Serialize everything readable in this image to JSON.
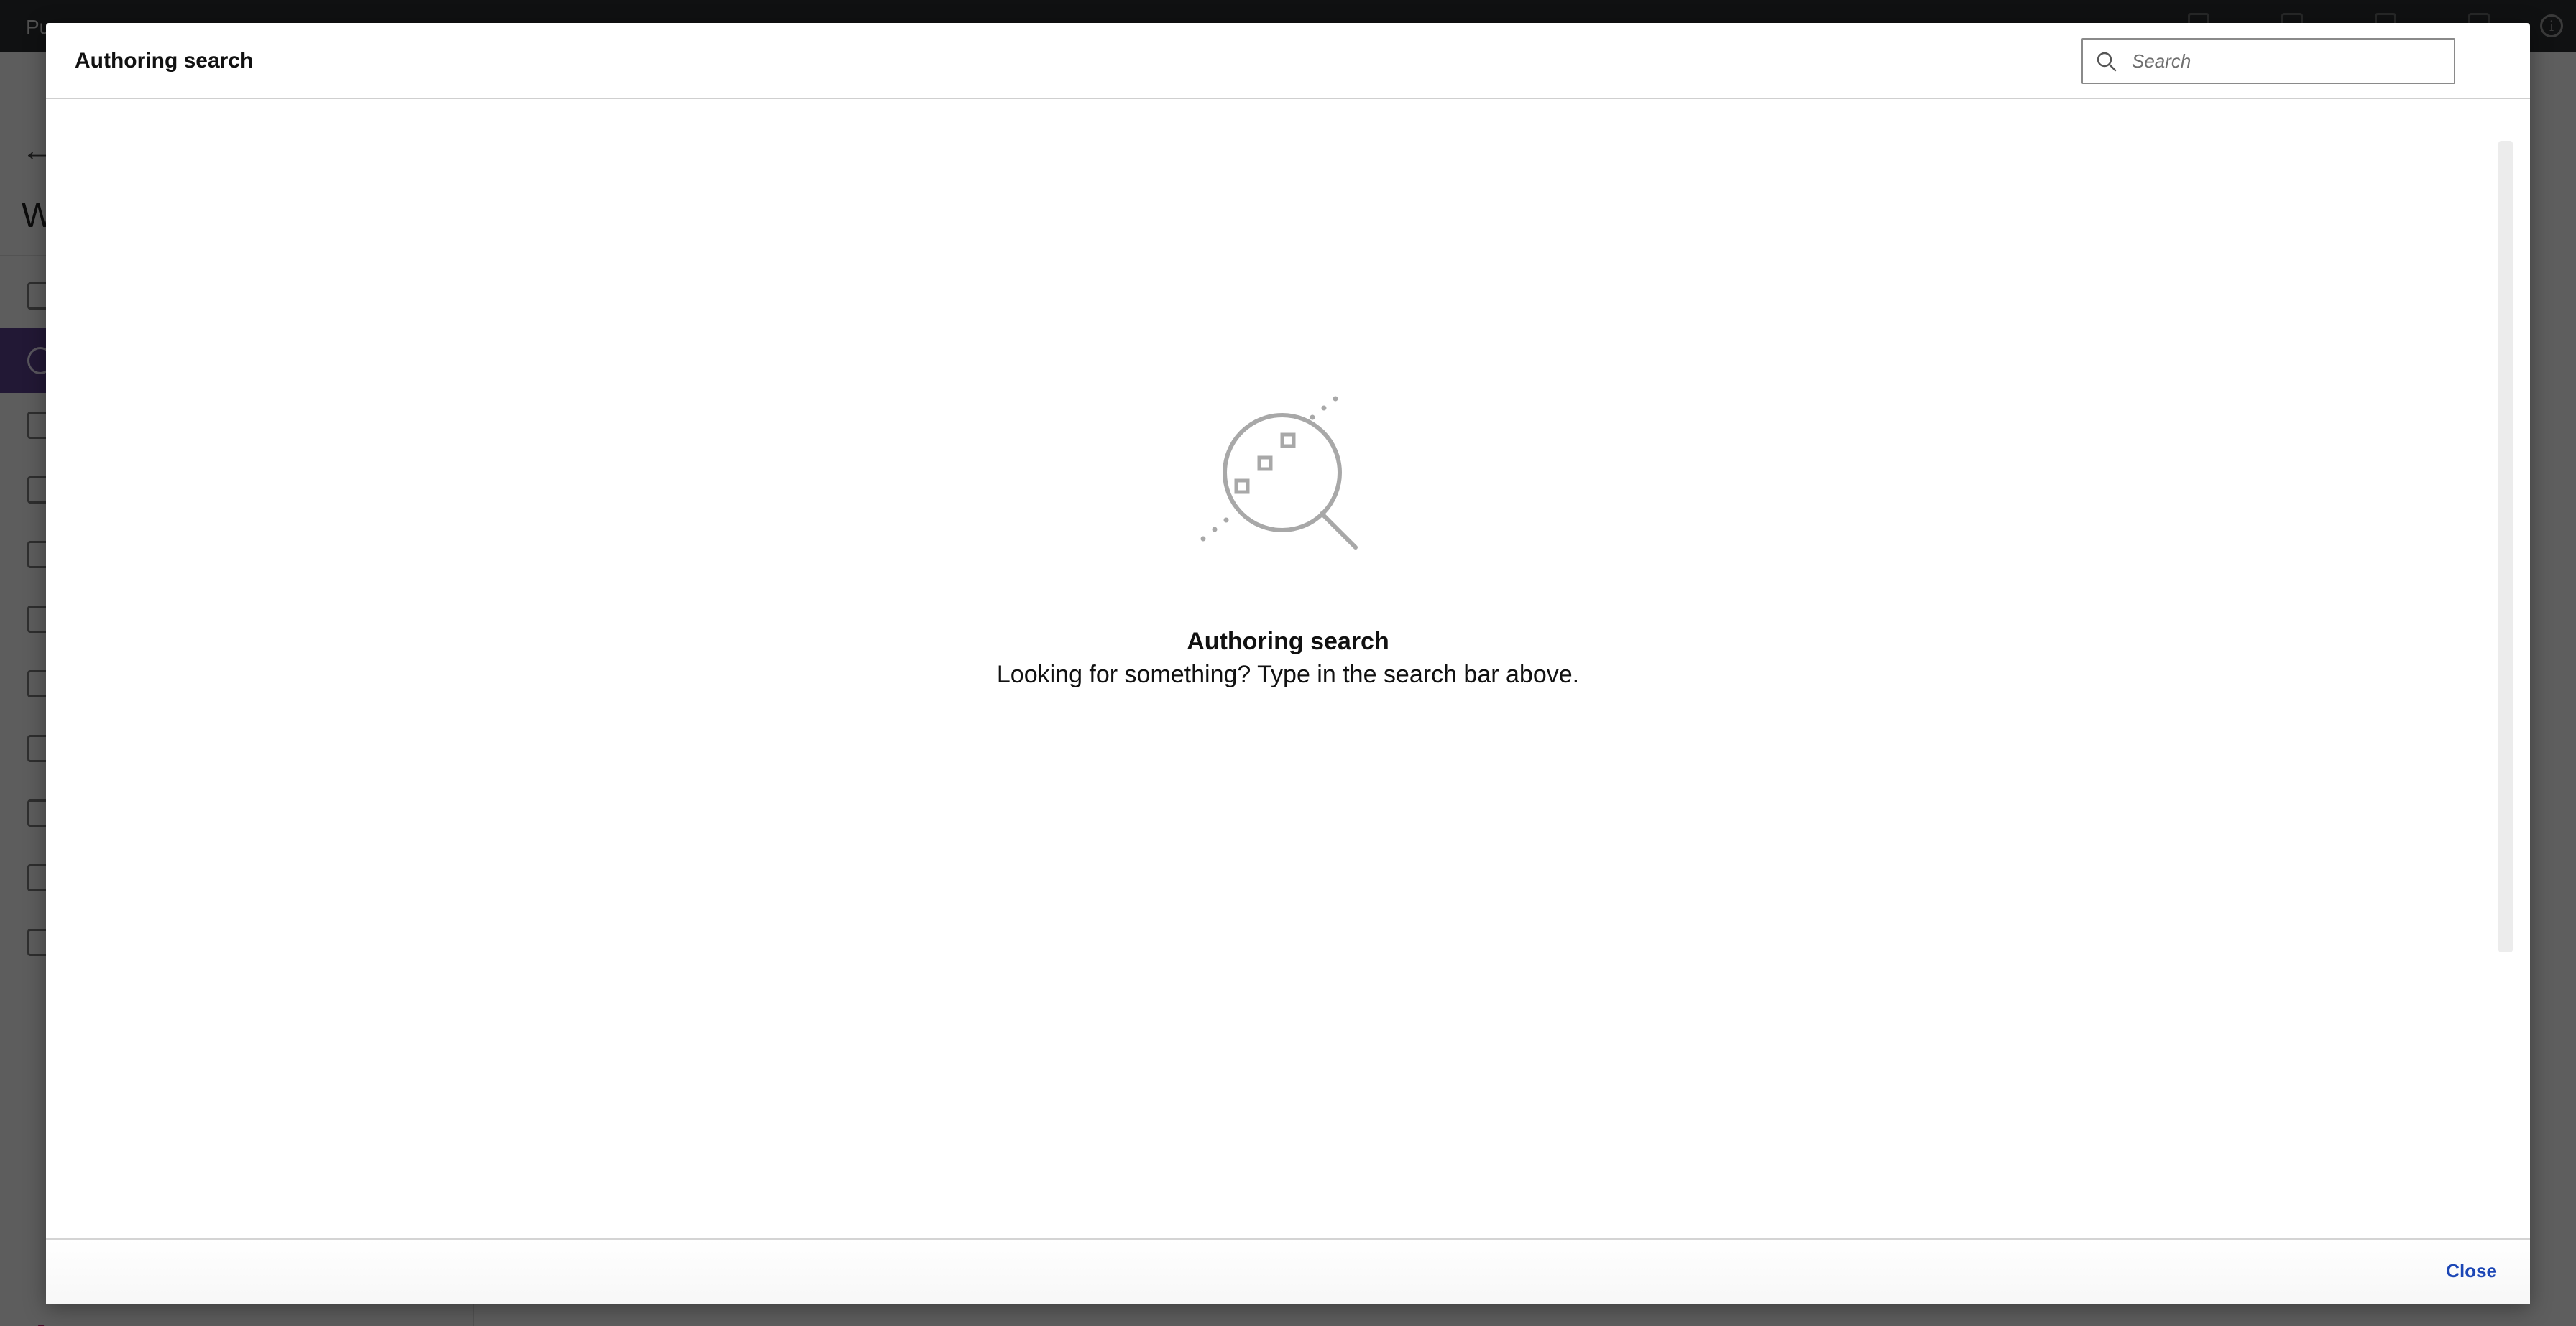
{
  "app": {
    "title": "Pu",
    "heading": "W"
  },
  "modal": {
    "title": "Authoring search",
    "search": {
      "placeholder": "Search",
      "value": ""
    },
    "empty_state": {
      "illustration": "magnifier-search-icon",
      "title": "Authoring search",
      "message": "Looking for something? Type in the search bar above."
    },
    "footer": {
      "close_label": "Close"
    }
  },
  "colors": {
    "link": "#1c46b5",
    "sidebar_active": "#5b3f8b",
    "illustration": "#a8a8a8"
  }
}
